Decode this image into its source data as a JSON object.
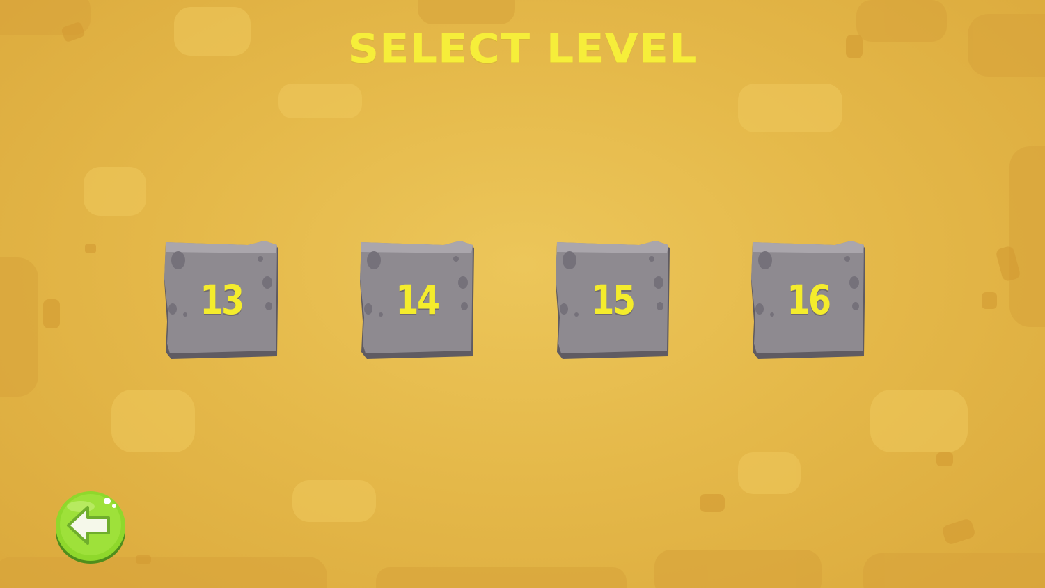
{
  "screen": {
    "title": "SELECT LEVEL"
  },
  "levels": [
    {
      "label": "13"
    },
    {
      "label": "14"
    },
    {
      "label": "15"
    },
    {
      "label": "16"
    }
  ],
  "controls": {
    "back_icon": "back-arrow-icon"
  },
  "colors": {
    "title": "#f6ee3a",
    "level_number": "#f4ec2c",
    "stone": "#8e8a90",
    "background": "#e5b94a",
    "back_button": "#8fd82c"
  }
}
